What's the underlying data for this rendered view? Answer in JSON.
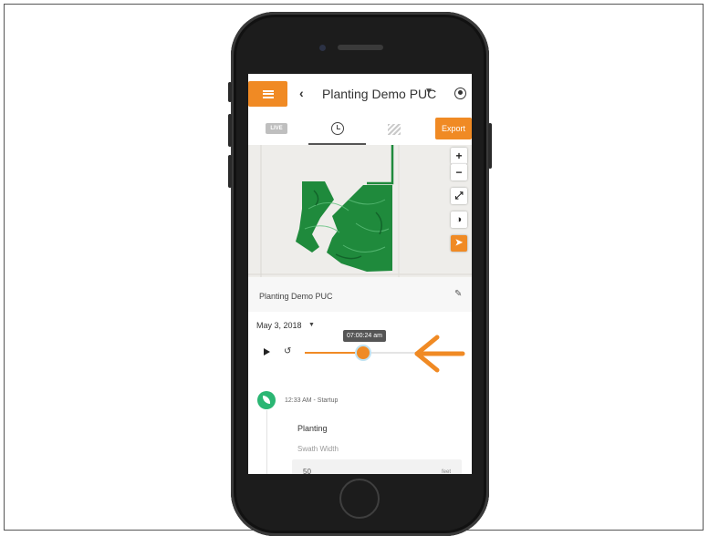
{
  "header": {
    "title": "Planting Demo PUC"
  },
  "tabs": {
    "live_label": "LIVE",
    "export_label": "Export"
  },
  "field": {
    "name": "Planting Demo PUC"
  },
  "playback": {
    "date": "May 3, 2018",
    "time_tooltip": "07:00:24 am",
    "progress_fraction": 0.38
  },
  "event": {
    "time_label": "12:33 AM - Startup",
    "title": "Planting",
    "swath_label": "Swath Width",
    "swath_value": "50",
    "swath_unit": "feet"
  },
  "colors": {
    "accent": "#f08a24",
    "map_track": "#1f8a3c",
    "event_icon": "#2bb673"
  },
  "icons": {
    "menu": "hamburger-icon",
    "back": "chevron-left-icon",
    "user": "user-circle-icon",
    "history": "history-icon",
    "zoom_in": "plus-icon",
    "zoom_out": "minus-icon",
    "fullscreen": "expand-icon",
    "layers": "globe-icon",
    "locate": "navigation-arrow-icon",
    "edit": "pencil-icon",
    "play": "play-icon",
    "replay": "replay-icon",
    "event": "leaf-icon"
  }
}
